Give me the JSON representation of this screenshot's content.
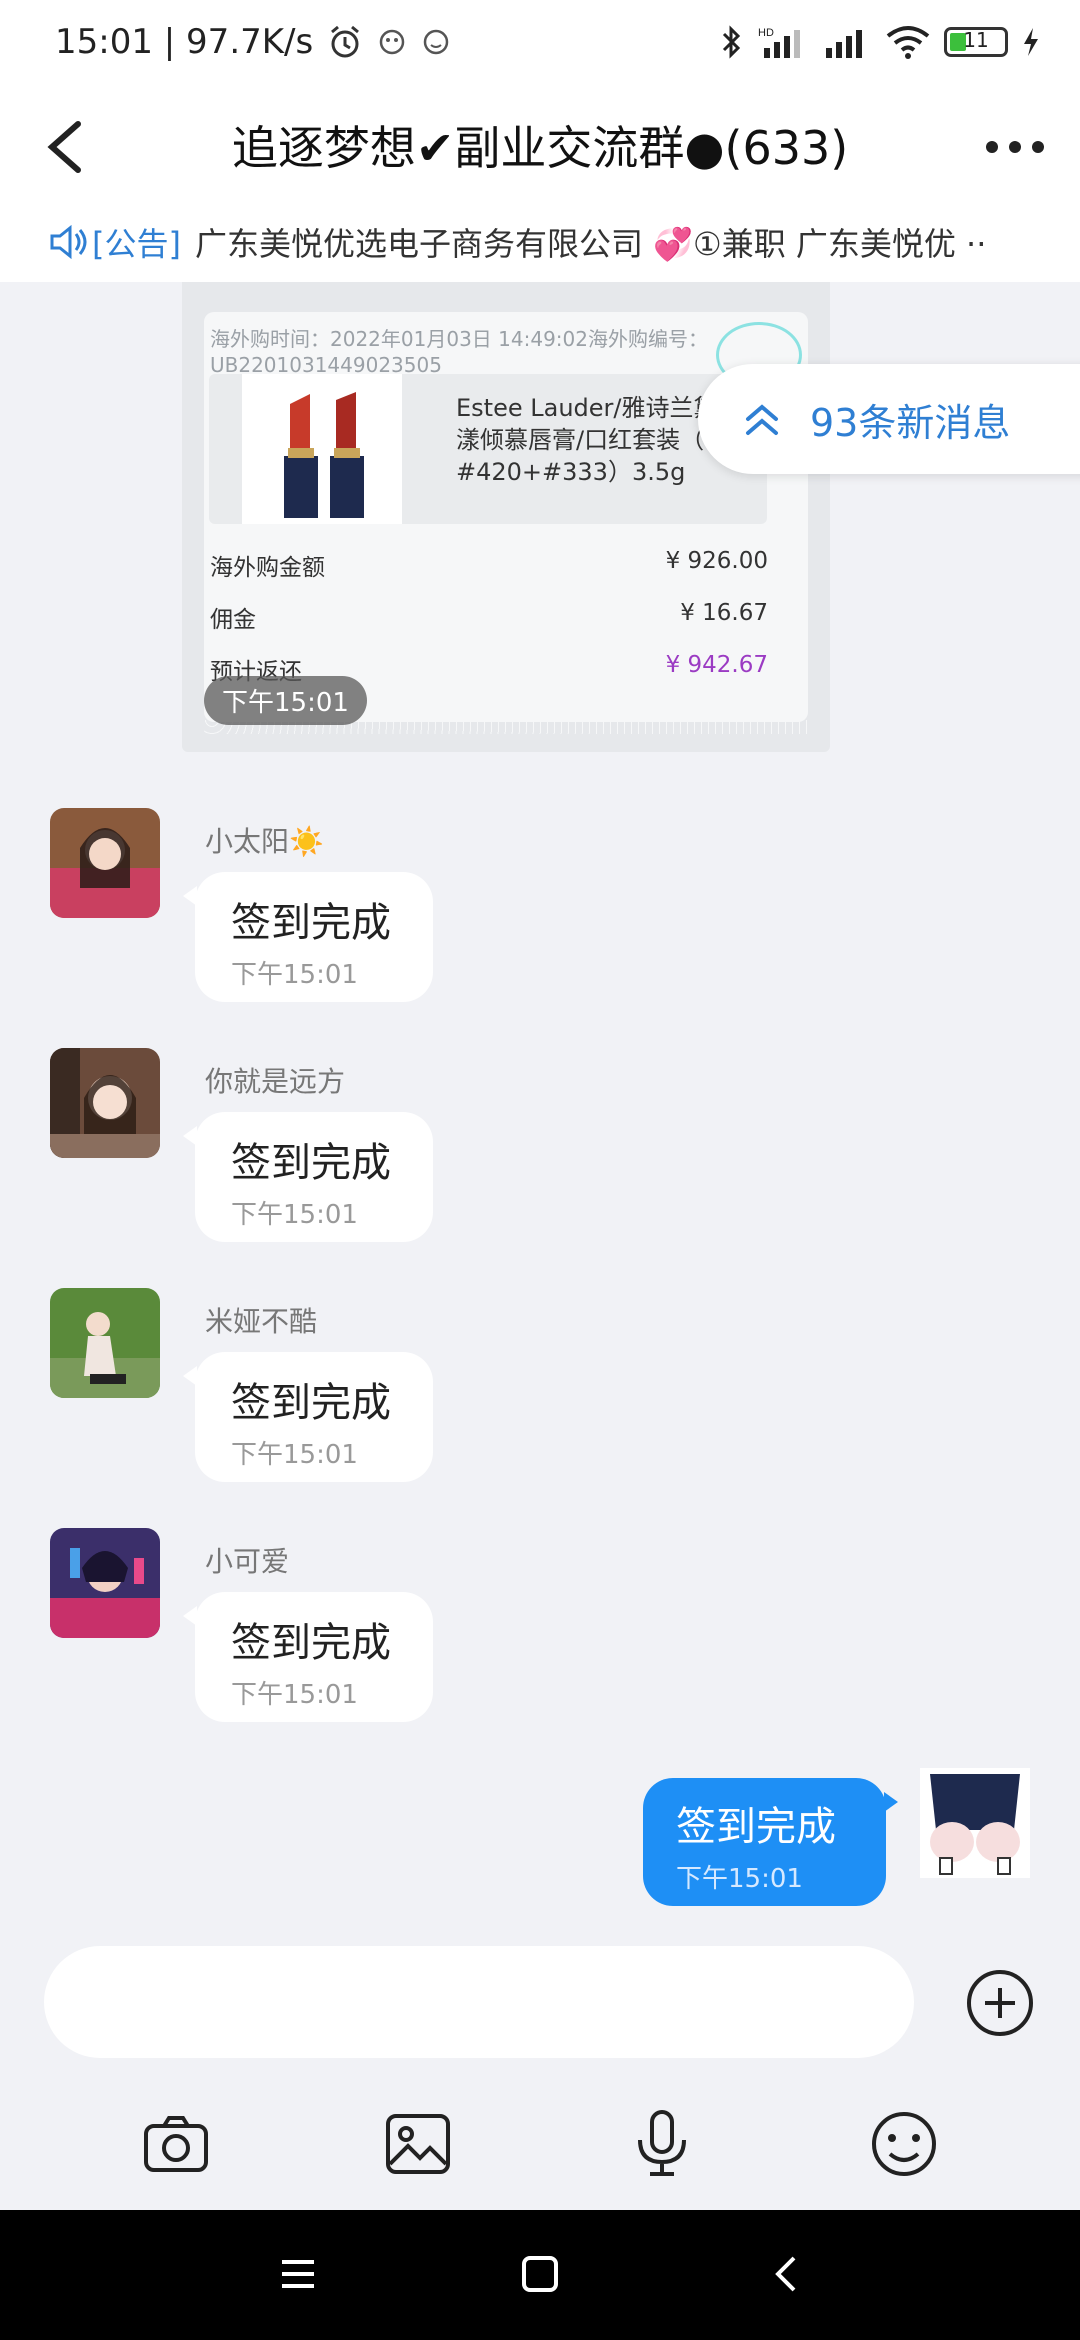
{
  "status_bar": {
    "time_speed": "15:01 | 97.7K/s",
    "battery": "11"
  },
  "header": {
    "title": "追逐梦想✔副业交流群●(633)"
  },
  "notice": {
    "tag": "[公告]",
    "text": "广东美悦优选电子商务有限公司 💞①兼职 广东美悦优 ··"
  },
  "order_card": {
    "meta_line1": "海外购时间：2022年01月03日 14:49:02海外购编号：",
    "meta_line2": "UB2201031449023505",
    "product_name": "Estee Lauder/雅诗兰黛花漾倾慕唇膏/口红套装（ #420+#333）3.5g",
    "amount_label": "海外购金额",
    "amount_value": "¥ 926.00",
    "commission_label": "佣金",
    "commission_value": "¥ 16.67",
    "return_label": "预计返还",
    "return_value": "¥ 942.67",
    "time_chip": "下午15:01"
  },
  "new_messages": {
    "label": "93条新消息"
  },
  "messages": [
    {
      "sender": "小太阳☀️",
      "text": "签到完成",
      "time": "下午15:01"
    },
    {
      "sender": "你就是远方",
      "text": "签到完成",
      "time": "下午15:01"
    },
    {
      "sender": "米娅不酷",
      "text": "签到完成",
      "time": "下午15:01"
    },
    {
      "sender": "小可爱",
      "text": "签到完成",
      "time": "下午15:01"
    }
  ],
  "my_message": {
    "text": "签到完成",
    "time": "下午15:01"
  },
  "colors": {
    "accent": "#1e8ff5",
    "link": "#2f7fd3",
    "background": "#f1f2f6"
  },
  "icons": [
    "back-icon",
    "more-icon",
    "speaker-icon",
    "double-chevron-up-icon",
    "plus-icon",
    "camera-icon",
    "image-icon",
    "microphone-icon",
    "emoji-icon",
    "menu-icon",
    "home-icon",
    "back-nav-icon"
  ]
}
